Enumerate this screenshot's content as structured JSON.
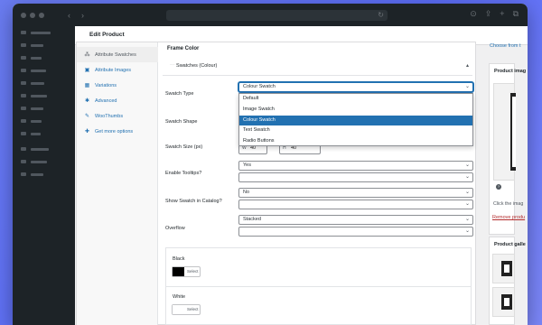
{
  "header": {
    "title": "Edit Product"
  },
  "panel": {
    "title": "Frame Color",
    "tabs": [
      {
        "label": "Attribute Swatches"
      },
      {
        "label": "Attribute Images"
      },
      {
        "label": "Variations"
      },
      {
        "label": "Advanced"
      },
      {
        "label": "WooThumbs"
      },
      {
        "label": "Get more options"
      }
    ],
    "swatches_header": "Swatches (Colour)",
    "fields": {
      "swatch_type": {
        "label": "Swatch Type",
        "value": "Colour Swatch"
      },
      "swatch_shape": {
        "label": "Swatch Shape"
      },
      "swatch_size": {
        "label": "Swatch Size (px)",
        "w_prefix": "W",
        "w_value": "40",
        "h_prefix": "H",
        "h_value": "40"
      },
      "tooltips": {
        "label": "Enable Tooltips?",
        "value": "Yes"
      },
      "show_catalog": {
        "label": "Show Swatch in Catalog?",
        "value": "No"
      },
      "overflow": {
        "label": "Overflow",
        "value": "Stacked"
      }
    },
    "dropdown_options": [
      "Default",
      "Image Swatch",
      "Colour Swatch",
      "Text Swatch",
      "Radio Buttons"
    ],
    "selected_option": "Colour Swatch",
    "colors": [
      {
        "name": "Black",
        "swatch": "#000000",
        "button": "Select"
      },
      {
        "name": "White",
        "swatch": "#ffffff",
        "button": "Select"
      }
    ]
  },
  "sidebar": {
    "link": "Choose from t",
    "product_image_title": "Product imag",
    "image_hint": "Click the imag",
    "remove_link": "Remove produ",
    "gallery_title": "Product galle"
  },
  "colors": {
    "accent": "#2271b1",
    "admin_dark": "#1d2327",
    "danger": "#b32d2e",
    "background": "#5b6cf5"
  }
}
